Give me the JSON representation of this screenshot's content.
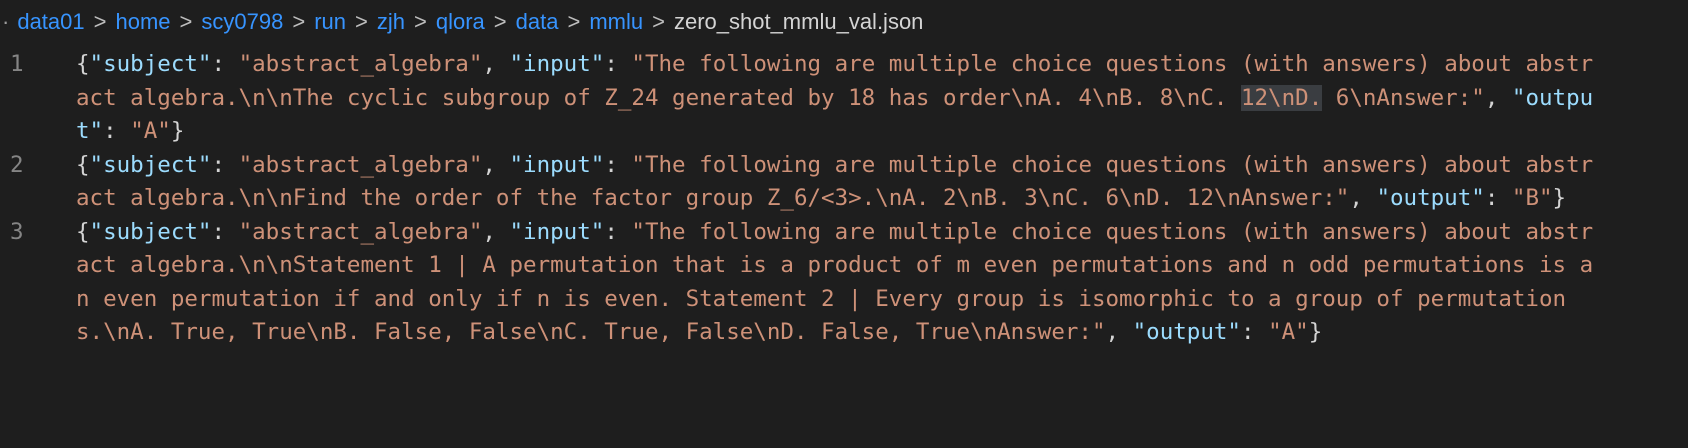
{
  "breadcrumb": {
    "lead": "·",
    "separator": ">",
    "items": [
      "data01",
      "home",
      "scy0798",
      "run",
      "zjh",
      "qlora",
      "data",
      "mmlu"
    ],
    "current": "zero_shot_mmlu_val.json"
  },
  "colors": {
    "background": "#1e1e1e",
    "key": "#9cdcfe",
    "string": "#ce9178",
    "punctuation": "#d4d4d4",
    "line_number": "#858585",
    "link": "#3794ff"
  },
  "editor": {
    "lines": [
      {
        "number": "1",
        "open": "{",
        "subject_key": "\"subject\"",
        "colon1": ": ",
        "subject_value": "\"abstract_algebra\"",
        "comma1": ", ",
        "input_key": "\"input\"",
        "colon2": ": ",
        "input_value_pre": "\"The following are multiple choice questions (with answers) about abstract algebra.\\n\\nThe cyclic subgroup of Z_24 generated by 18 has order\\nA. 4\\nB. 8\\nC. ",
        "input_value_highlight": "12\\nD.",
        "input_value_post": " 6\\nAnswer:\"",
        "comma2": ", ",
        "output_key": "\"output\"",
        "colon3": ": ",
        "output_value": "\"A\"",
        "close": "}"
      },
      {
        "number": "2",
        "open": "{",
        "subject_key": "\"subject\"",
        "colon1": ": ",
        "subject_value": "\"abstract_algebra\"",
        "comma1": ", ",
        "input_key": "\"input\"",
        "colon2": ": ",
        "input_value": "\"The following are multiple choice questions (with answers) about abstract algebra.\\n\\nFind the order of the factor group Z_6/<3>.\\nA. 2\\nB. 3\\nC. 6\\nD. 12\\nAnswer:\"",
        "comma2": ", ",
        "output_key": "\"output\"",
        "colon3": ": ",
        "output_value": "\"B\"",
        "close": "}"
      },
      {
        "number": "3",
        "open": "{",
        "subject_key": "\"subject\"",
        "colon1": ": ",
        "subject_value": "\"abstract_algebra\"",
        "comma1": ", ",
        "input_key": "\"input\"",
        "colon2": ": ",
        "input_value": "\"The following are multiple choice questions (with answers) about abstract algebra.\\n\\nStatement 1 | A permutation that is a product of m even permutations and n odd permutations is an even permutation if and only if n is even. Statement 2 | Every group is isomorphic to a group of permutations.\\nA. True, True\\nB. False, False\\nC. True, False\\nD. False, True\\nAnswer:\"",
        "comma2": ", ",
        "output_key": "\"output\"",
        "colon3": ": ",
        "output_value": "\"A\"",
        "close": "}"
      }
    ]
  }
}
